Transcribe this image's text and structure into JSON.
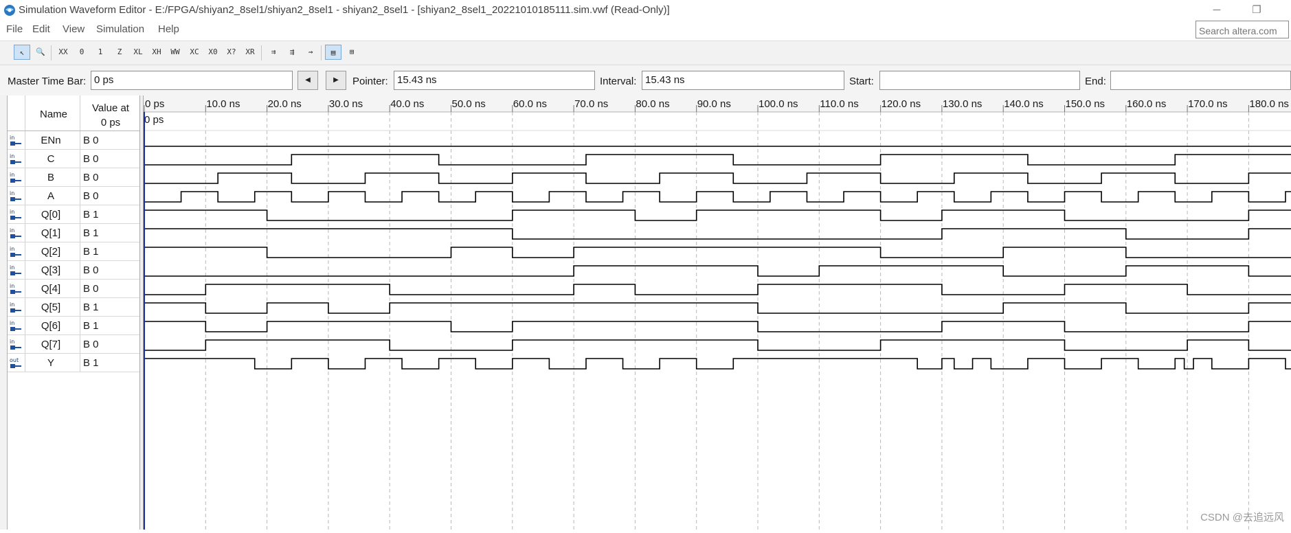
{
  "window": {
    "title": "Simulation Waveform Editor - E:/FPGA/shiyan2_8sel1/shiyan2_8sel1 - shiyan2_8sel1 - [shiyan2_8sel1_20221010185111.sim.vwf (Read-Only)]",
    "minimize_glyph": "─",
    "restore_glyph": "❐"
  },
  "menu": [
    "File",
    "Edit",
    "View",
    "Simulation",
    "Help"
  ],
  "search": {
    "placeholder": "Search altera.com"
  },
  "toolbar": {
    "tools": [
      {
        "name": "selection-tool-icon",
        "glyph": "↖",
        "active": true
      },
      {
        "name": "zoom-tool-icon",
        "glyph": "🔍",
        "active": false
      },
      {
        "name": "unknown-value-icon",
        "glyph": "XX",
        "active": false
      },
      {
        "name": "forcing-low-icon",
        "glyph": "0",
        "active": false
      },
      {
        "name": "forcing-high-icon",
        "glyph": "1",
        "active": false
      },
      {
        "name": "high-impedance-icon",
        "glyph": "Z",
        "active": false
      },
      {
        "name": "weak-low-icon",
        "glyph": "XL",
        "active": false
      },
      {
        "name": "weak-high-icon",
        "glyph": "XH",
        "active": false
      },
      {
        "name": "dont-care-icon",
        "glyph": "WW",
        "active": false
      },
      {
        "name": "invert-icon",
        "glyph": "XC",
        "active": false
      },
      {
        "name": "count-value-icon",
        "glyph": "X0",
        "active": false
      },
      {
        "name": "arbitrary-value-icon",
        "glyph": "X?",
        "active": false
      },
      {
        "name": "random-value-icon",
        "glyph": "XR",
        "active": false
      },
      {
        "name": "snap-to-grid-icon",
        "glyph": "⇉",
        "active": false
      },
      {
        "name": "sort-icon",
        "glyph": "⇶",
        "active": false
      },
      {
        "name": "overwrite-clock-icon",
        "glyph": "⇝",
        "active": false
      },
      {
        "name": "grid-view-icon",
        "glyph": "▤",
        "active": true
      },
      {
        "name": "group-icon",
        "glyph": "⊞",
        "active": false
      }
    ]
  },
  "timebar": {
    "master_label": "Master Time Bar:",
    "master_value": "0 ps",
    "prev_glyph": "◀",
    "next_glyph": "▶",
    "pointer_label": "Pointer:",
    "pointer_value": "15.43 ns",
    "interval_label": "Interval:",
    "interval_value": "15.43 ns",
    "start_label": "Start:",
    "start_value": "",
    "end_label": "End:",
    "end_value": ""
  },
  "signal_header": {
    "name": "Name",
    "value_line1": "Value at",
    "value_line2": "0 ps"
  },
  "time_axis": {
    "ticks": [
      "0 ps",
      "10.0 ns",
      "20.0 ns",
      "30.0 ns",
      "40.0 ns",
      "50.0 ns",
      "60.0 ns",
      "70.0 ns",
      "80.0 ns",
      "90.0 ns",
      "100.0 ns",
      "110.0 ns",
      "120.0 ns",
      "130.0 ns",
      "140.0 ns",
      "150.0 ns",
      "160.0 ns",
      "170.0 ns",
      "180.0 ns"
    ],
    "cursor_label": "0 ps",
    "max_time_ns": 187.5,
    "tick_step_ns": 10
  },
  "signals": [
    {
      "dir": "in",
      "name": "ENn",
      "value": "B 0",
      "edges_ns": [],
      "initial": 0
    },
    {
      "dir": "in",
      "name": "C",
      "value": "B 0",
      "edges_ns": [
        24,
        48,
        72,
        96,
        120,
        144,
        168
      ],
      "initial": 0
    },
    {
      "dir": "in",
      "name": "B",
      "value": "B 0",
      "edges_ns": [
        12,
        24,
        36,
        48,
        60,
        72,
        84,
        96,
        108,
        120,
        132,
        144,
        156,
        168,
        180
      ],
      "initial": 0
    },
    {
      "dir": "in",
      "name": "A",
      "value": "B 0",
      "edges_ns": [
        6,
        12,
        18,
        24,
        30,
        36,
        42,
        48,
        54,
        60,
        66,
        72,
        78,
        84,
        90,
        96,
        102,
        108,
        114,
        120,
        126,
        132,
        138,
        144,
        150,
        156,
        162,
        168,
        174,
        180,
        186
      ],
      "initial": 0
    },
    {
      "dir": "in",
      "name": "Q[0]",
      "value": "B 1",
      "edges_ns": [
        20,
        60,
        80,
        90,
        120,
        130,
        150,
        180
      ],
      "initial": 1
    },
    {
      "dir": "in",
      "name": "Q[1]",
      "value": "B 1",
      "edges_ns": [
        60,
        130,
        160,
        180
      ],
      "initial": 1
    },
    {
      "dir": "in",
      "name": "Q[2]",
      "value": "B 1",
      "edges_ns": [
        20,
        50,
        60,
        70,
        120,
        140,
        160
      ],
      "initial": 1
    },
    {
      "dir": "in",
      "name": "Q[3]",
      "value": "B 0",
      "edges_ns": [
        70,
        100,
        110,
        140,
        160,
        180
      ],
      "initial": 0
    },
    {
      "dir": "in",
      "name": "Q[4]",
      "value": "B 0",
      "edges_ns": [
        10,
        40,
        70,
        80,
        100,
        130,
        150,
        170
      ],
      "initial": 0
    },
    {
      "dir": "in",
      "name": "Q[5]",
      "value": "B 1",
      "edges_ns": [
        10,
        20,
        30,
        40,
        100,
        140,
        160,
        180
      ],
      "initial": 1
    },
    {
      "dir": "in",
      "name": "Q[6]",
      "value": "B 1",
      "edges_ns": [
        10,
        20,
        50,
        60,
        100,
        130,
        150,
        180
      ],
      "initial": 1
    },
    {
      "dir": "in",
      "name": "Q[7]",
      "value": "B 0",
      "edges_ns": [
        10,
        40,
        60,
        100,
        120,
        150,
        170,
        180
      ],
      "initial": 0
    },
    {
      "dir": "out",
      "name": "Y",
      "value": "B 1",
      "edges_ns": [
        18,
        24,
        30,
        36,
        42,
        48,
        54,
        60,
        66,
        72,
        78,
        84,
        90,
        96,
        126,
        130,
        132,
        135,
        138,
        144,
        150,
        156,
        162,
        168,
        169.5,
        171,
        174,
        180,
        186
      ],
      "initial": 1
    }
  ],
  "watermark": "CSDN @去追远风",
  "colors": {
    "wave": "#000000",
    "grid": "#b8b8b8",
    "cursor": "#1c2fa8",
    "accent": "#1e4fa0"
  }
}
